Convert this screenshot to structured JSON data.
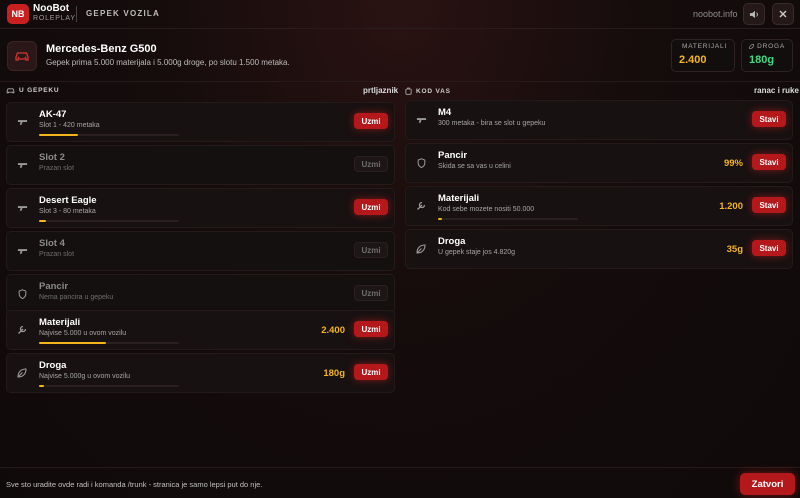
{
  "brand": {
    "logo": "NB",
    "name": "NooBot",
    "tagline": "ROLEPLAY"
  },
  "section_title": "GEPEK VOZILA",
  "site": "noobot.info",
  "vehicle": {
    "name": "Mercedes-Benz G500",
    "description": "Gepek prima 5.000 materijala i 5.000g droge, po slotu 1.500 metaka."
  },
  "stats": {
    "materijali": {
      "label": "MATERIJALI",
      "value": "2.400",
      "color": "#f2b51c"
    },
    "droga": {
      "label": "DROGA",
      "value": "180g",
      "color": "#3ddc84"
    }
  },
  "trunk": {
    "heading": "U GEPEKU",
    "right_label": "prtljaznik",
    "items": [
      {
        "title": "AK-47",
        "sub": "Slot 1 - 420 metaka",
        "value": "",
        "button": "Uzmi",
        "enabled": true,
        "fill": 0.28,
        "icon": "gun-icon"
      },
      {
        "title": "Slot 2",
        "sub": "Prazan slot",
        "value": "",
        "button": "Uzmi",
        "enabled": false,
        "fill": null,
        "icon": "gun-icon"
      },
      {
        "title": "Desert Eagle",
        "sub": "Slot 3 - 80 metaka",
        "value": "",
        "button": "Uzmi",
        "enabled": true,
        "fill": 0.05,
        "icon": "gun-icon"
      },
      {
        "title": "Slot 4",
        "sub": "Prazan slot",
        "value": "",
        "button": "Uzmi",
        "enabled": false,
        "fill": null,
        "icon": "gun-icon"
      },
      {
        "title": "Pancir",
        "sub": "Nema pancira u gepeku",
        "value": "",
        "button": "Uzmi",
        "enabled": false,
        "fill": null,
        "icon": "shield-icon"
      },
      {
        "title": "Materijali",
        "sub": "Najvise 5.000 u ovom vozilu",
        "value": "2.400",
        "button": "Uzmi",
        "enabled": true,
        "fill": 0.48,
        "icon": "wrench-icon"
      },
      {
        "title": "Droga",
        "sub": "Najvise 5.000g u ovom vozilu",
        "value": "180g",
        "button": "Uzmi",
        "enabled": true,
        "fill": 0.036,
        "icon": "leaf-icon"
      }
    ]
  },
  "pocket": {
    "heading": "KOD VAS",
    "right_label": "ranac i ruke",
    "items": [
      {
        "title": "M4",
        "sub": "300 metaka - bira se slot u gepeku",
        "value": "",
        "button": "Stavi",
        "enabled": true,
        "fill": null,
        "icon": "gun-icon"
      },
      {
        "title": "Pancir",
        "sub": "Skida se sa vas u celini",
        "value": "99%",
        "button": "Stavi",
        "enabled": true,
        "fill": null,
        "icon": "shield-icon"
      },
      {
        "title": "Materijali",
        "sub": "Kod sebe mozete nositi 50.000",
        "value": "1.200",
        "button": "Stavi",
        "enabled": true,
        "fill": 0.024,
        "icon": "wrench-icon"
      },
      {
        "title": "Droga",
        "sub": "U gepek staje jos 4.820g",
        "value": "35g",
        "button": "Stavi",
        "enabled": true,
        "fill": null,
        "icon": "leaf-icon"
      }
    ]
  },
  "footer": {
    "text": "Sve sto uradite ovde radi i komanda /trunk - stranica je samo lepsi put do nje.",
    "close_label": "Zatvori"
  },
  "colors": {
    "accent": "#b5181b",
    "gold": "#f2b51c",
    "green": "#3ddc84"
  }
}
